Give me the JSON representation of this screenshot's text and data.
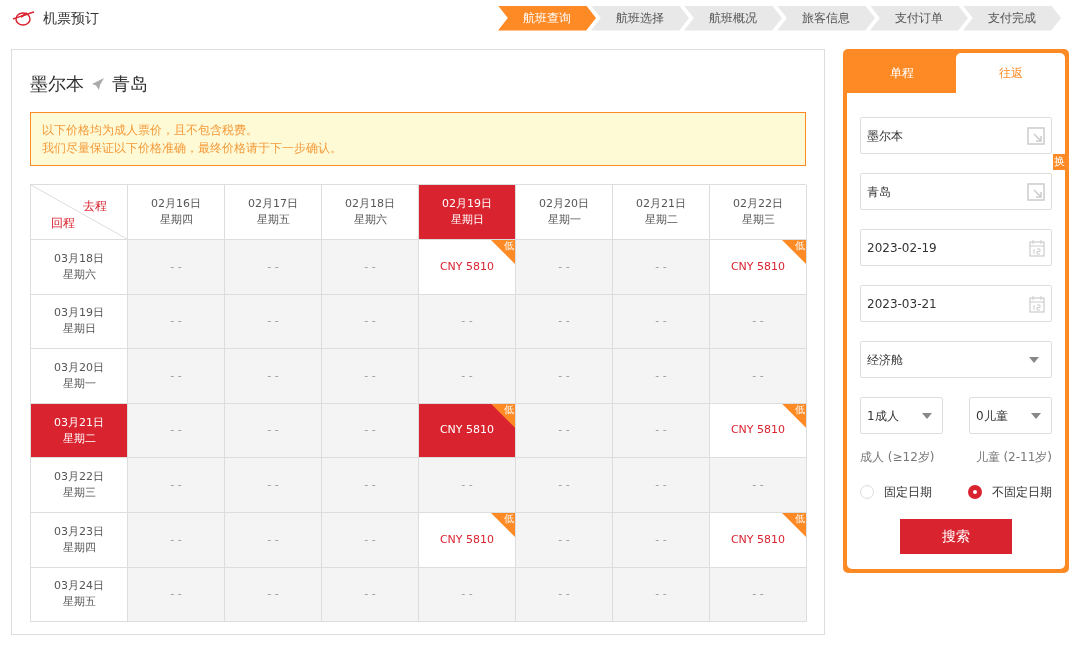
{
  "title": "机票预订",
  "steps": [
    {
      "label": "航班查询",
      "selected": true
    },
    {
      "label": "航班选择",
      "selected": false
    },
    {
      "label": "航班概况",
      "selected": false
    },
    {
      "label": "旅客信息",
      "selected": false
    },
    {
      "label": "支付订单",
      "selected": false
    },
    {
      "label": "支付完成",
      "selected": false
    }
  ],
  "route": {
    "from": "墨尔本",
    "to": "青岛"
  },
  "notice": [
    "以下价格均为成人票价，且不包含税费。",
    "我们尽量保证以下价格准确，最终价格请于下一步确认。"
  ],
  "grid": {
    "corner": {
      "outbound": "去程",
      "return": "回程"
    },
    "columns": [
      {
        "date": "02月16日",
        "weekday": "星期四",
        "selected": false
      },
      {
        "date": "02月17日",
        "weekday": "星期五",
        "selected": false
      },
      {
        "date": "02月18日",
        "weekday": "星期六",
        "selected": false
      },
      {
        "date": "02月19日",
        "weekday": "星期日",
        "selected": true
      },
      {
        "date": "02月20日",
        "weekday": "星期一",
        "selected": false
      },
      {
        "date": "02月21日",
        "weekday": "星期二",
        "selected": false
      },
      {
        "date": "02月22日",
        "weekday": "星期三",
        "selected": false
      }
    ],
    "rows": [
      {
        "date": "03月18日",
        "weekday": "星期六",
        "selected": false,
        "cells": [
          {
            "price": "- -",
            "low": false,
            "selected": false
          },
          {
            "price": "- -",
            "low": false,
            "selected": false
          },
          {
            "price": "- -",
            "low": false,
            "selected": false
          },
          {
            "price": "CNY 5810",
            "low": true,
            "badge": "低",
            "selected": false
          },
          {
            "price": "- -",
            "low": false,
            "selected": false
          },
          {
            "price": "- -",
            "low": false,
            "selected": false
          },
          {
            "price": "CNY 5810",
            "low": true,
            "badge": "低",
            "selected": false
          }
        ]
      },
      {
        "date": "03月19日",
        "weekday": "星期日",
        "selected": false,
        "cells": [
          {
            "price": "- -",
            "low": false,
            "selected": false
          },
          {
            "price": "- -",
            "low": false,
            "selected": false
          },
          {
            "price": "- -",
            "low": false,
            "selected": false
          },
          {
            "price": "- -",
            "low": false,
            "selected": false
          },
          {
            "price": "- -",
            "low": false,
            "selected": false
          },
          {
            "price": "- -",
            "low": false,
            "selected": false
          },
          {
            "price": "- -",
            "low": false,
            "selected": false
          }
        ]
      },
      {
        "date": "03月20日",
        "weekday": "星期一",
        "selected": false,
        "cells": [
          {
            "price": "- -",
            "low": false,
            "selected": false
          },
          {
            "price": "- -",
            "low": false,
            "selected": false
          },
          {
            "price": "- -",
            "low": false,
            "selected": false
          },
          {
            "price": "- -",
            "low": false,
            "selected": false
          },
          {
            "price": "- -",
            "low": false,
            "selected": false
          },
          {
            "price": "- -",
            "low": false,
            "selected": false
          },
          {
            "price": "- -",
            "low": false,
            "selected": false
          }
        ]
      },
      {
        "date": "03月21日",
        "weekday": "星期二",
        "selected": true,
        "cells": [
          {
            "price": "- -",
            "low": false,
            "selected": false
          },
          {
            "price": "- -",
            "low": false,
            "selected": false
          },
          {
            "price": "- -",
            "low": false,
            "selected": false
          },
          {
            "price": "CNY 5810",
            "low": true,
            "badge": "低",
            "selected": true
          },
          {
            "price": "- -",
            "low": false,
            "selected": false
          },
          {
            "price": "- -",
            "low": false,
            "selected": false
          },
          {
            "price": "CNY 5810",
            "low": true,
            "badge": "低",
            "selected": false
          }
        ]
      },
      {
        "date": "03月22日",
        "weekday": "星期三",
        "selected": false,
        "cells": [
          {
            "price": "- -",
            "low": false,
            "selected": false
          },
          {
            "price": "- -",
            "low": false,
            "selected": false
          },
          {
            "price": "- -",
            "low": false,
            "selected": false
          },
          {
            "price": "- -",
            "low": false,
            "selected": false
          },
          {
            "price": "- -",
            "low": false,
            "selected": false
          },
          {
            "price": "- -",
            "low": false,
            "selected": false
          },
          {
            "price": "- -",
            "low": false,
            "selected": false
          }
        ]
      },
      {
        "date": "03月23日",
        "weekday": "星期四",
        "selected": false,
        "cells": [
          {
            "price": "- -",
            "low": false,
            "selected": false
          },
          {
            "price": "- -",
            "low": false,
            "selected": false
          },
          {
            "price": "- -",
            "low": false,
            "selected": false
          },
          {
            "price": "CNY 5810",
            "low": true,
            "badge": "低",
            "selected": false
          },
          {
            "price": "- -",
            "low": false,
            "selected": false
          },
          {
            "price": "- -",
            "low": false,
            "selected": false
          },
          {
            "price": "CNY 5810",
            "low": true,
            "badge": "低",
            "selected": false
          }
        ]
      },
      {
        "date": "03月24日",
        "weekday": "星期五",
        "selected": false,
        "cells": [
          {
            "price": "- -",
            "low": false,
            "selected": false
          },
          {
            "price": "- -",
            "low": false,
            "selected": false
          },
          {
            "price": "- -",
            "low": false,
            "selected": false
          },
          {
            "price": "- -",
            "low": false,
            "selected": false
          },
          {
            "price": "- -",
            "low": false,
            "selected": false
          },
          {
            "price": "- -",
            "low": false,
            "selected": false
          },
          {
            "price": "- -",
            "low": false,
            "selected": false
          }
        ]
      }
    ]
  },
  "search": {
    "tabs": [
      {
        "label": "单程",
        "selected": false
      },
      {
        "label": "往返",
        "selected": true
      }
    ],
    "from": "墨尔本",
    "to": "青岛",
    "swap": "换",
    "depart_date": "2023-02-19",
    "return_date": "2023-03-21",
    "cabin": "经济舱",
    "adults": "1成人",
    "children": "0儿童",
    "adult_note": "成人 (≥12岁)",
    "child_note": "儿童 (2-11岁)",
    "radios": [
      {
        "label": "固定日期",
        "selected": false
      },
      {
        "label": "不固定日期",
        "selected": true
      }
    ],
    "button": "搜索"
  }
}
